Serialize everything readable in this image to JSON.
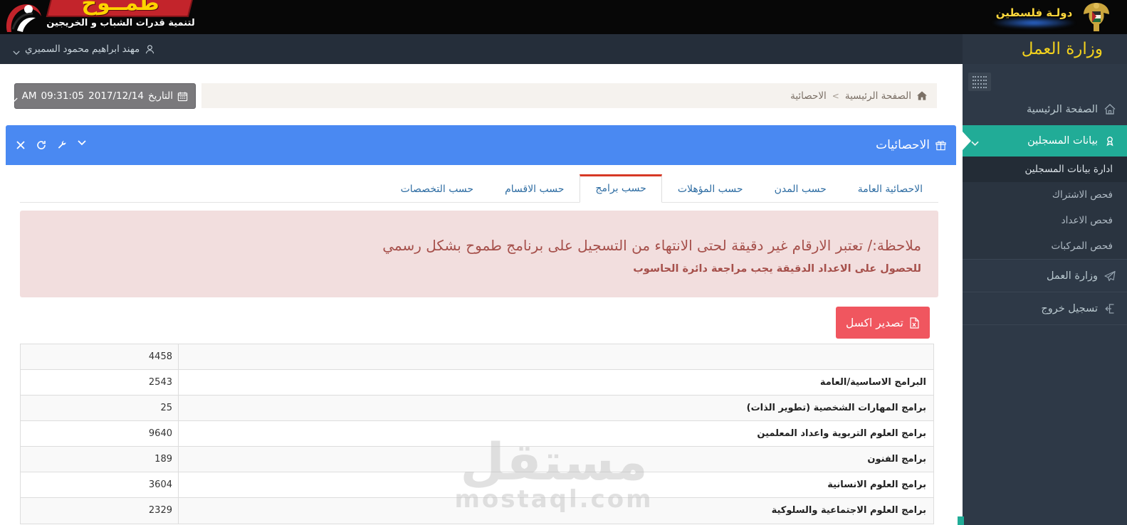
{
  "brand": {
    "wordmark": "طمــوح",
    "tagline": "لتنمية قدرات الشباب و الخريجين",
    "state": "دولـة فلسطين"
  },
  "user_bar": {
    "name": "مهند ابراهيم محمود السميري"
  },
  "sidebar": {
    "title": "وزارة العمل",
    "home": "الصفحة الرئيسية",
    "registrants": "بيانات المسجلين",
    "submenu": [
      {
        "label": "ادارة بيانات المسجلين",
        "active": true
      },
      {
        "label": "فحص الاشتراك",
        "active": false
      },
      {
        "label": "فحص الاعداد",
        "active": false
      },
      {
        "label": "فحص المركبات",
        "active": false
      }
    ],
    "ministry": "وزارة العمل",
    "logout": "تسجيل خروج"
  },
  "content_header": {
    "date_button": {
      "label": "التاريخ",
      "date": "2017/12/14",
      "time": "09:31:05",
      "meridiem": "AM"
    },
    "breadcrumb": {
      "home": "الصفحة الرئيسية",
      "separator": ">",
      "current": "الاحصائية"
    }
  },
  "panel": {
    "title": "الاحصائيات"
  },
  "tabs": [
    {
      "label": "الاحصائية العامة",
      "active": false
    },
    {
      "label": "حسب المدن",
      "active": false
    },
    {
      "label": "حسب المؤهلات",
      "active": false
    },
    {
      "label": "حسب برامج",
      "active": true
    },
    {
      "label": "حسب الاقسام",
      "active": false
    },
    {
      "label": "حسب التخصصات",
      "active": false
    }
  ],
  "notice": {
    "line1": "ملاحظة:/ تعتبر الارقام غير دقيقة لحتى الانتهاء من التسجيل على برنامج طموح بشكل رسمي",
    "line2": "للحصول على الاعداد الدقيقة يجب مراجعة دائرة الحاسوب"
  },
  "export_button": {
    "label": "تصدير اكسل"
  },
  "table": {
    "rows": [
      {
        "label": "",
        "value": "4458"
      },
      {
        "label": "البرامج الاساسية/العامة",
        "value": "2543"
      },
      {
        "label": "برامج المهارات الشخصية (تطوير الذات)",
        "value": "25"
      },
      {
        "label": "برامج العلوم التربوية واعداد المعلمين",
        "value": "9640"
      },
      {
        "label": "برامج الفنون",
        "value": "189"
      },
      {
        "label": "برامج العلوم الانسانية",
        "value": "3604"
      },
      {
        "label": "برامج العلوم الاجتماعية والسلوكية",
        "value": "2329"
      }
    ]
  },
  "watermark": {
    "arabic": "مستقل",
    "latin": "mostaql.com"
  },
  "colors": {
    "accent_blue": "#4a89f2",
    "active_teal": "#21ac97",
    "brand_red": "#c3242b",
    "brand_yellow": "#ffd400",
    "ministry_yellow": "#f3d21d",
    "tab_active_border": "#d73925",
    "export_red": "#f0565f",
    "notice_bg": "#f2dede",
    "notice_text": "#a6504b",
    "sidebar_bg": "#2e3947"
  }
}
